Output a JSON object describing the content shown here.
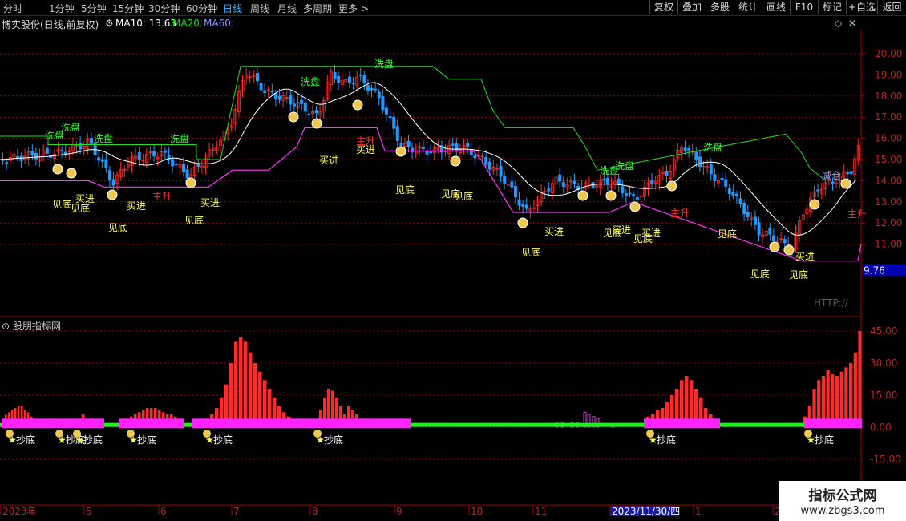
{
  "toolbar": {
    "period_tabs": [
      "分时",
      "1分钟",
      "5分钟",
      "15分钟",
      "30分钟",
      "60分钟",
      "日线",
      "周线",
      "月线",
      "多周期",
      "更多 >"
    ],
    "active_tab": "日线",
    "buttons": [
      "复权",
      "叠加",
      "多股",
      "统计",
      "画线",
      "F10",
      "标记",
      "+自选",
      "返回"
    ]
  },
  "infobar": {
    "stock_title": "博实股份(日线,前复权)",
    "ma10_label": "MA10: 13.63",
    "ma20_label": "MA20:",
    "ma60_label": "MA60:",
    "ma10_color": "#ffffff",
    "ma20_color": "#00e600",
    "ma60_color": "#8f8fff"
  },
  "price_axis": {
    "ticks": [
      "20.00",
      "19.00",
      "18.00",
      "17.00",
      "16.00",
      "15.00",
      "14.00",
      "13.00",
      "12.00",
      "11.00"
    ],
    "current_price": "9.76",
    "current_price_bg": "#0000b0",
    "watermark_text": "HTTP://"
  },
  "annotations": {
    "wash": "洗盘",
    "buy": "买进",
    "bottom": "见底",
    "main_rise": "主升",
    "reduce": "减仓"
  },
  "indicator": {
    "title": "股朋指标网",
    "ticks": [
      "45.00",
      "30.00",
      "15.00",
      "0.00",
      "-15.00"
    ],
    "signal": "抄底"
  },
  "date_axis": {
    "labels": [
      "2023年",
      "5",
      "6",
      "7",
      "8",
      "9",
      "10",
      "11",
      "2023/11/30/四",
      "1",
      "2"
    ]
  },
  "watermark": {
    "line1": "指标公式网",
    "line2": "www.zbgs3.com"
  },
  "colors": {
    "up": "#ff2a2a",
    "down": "#1f9bff",
    "wash_line": "#22dd22",
    "support_line": "#ff33ff",
    "ma_line": "#ffffff",
    "axis_red": "#aa0000",
    "label_yellow": "#ffff55",
    "label_red": "#ff3030",
    "label_green": "#33ff33",
    "signal_bar": "#ff22ff",
    "signal_base": "#22ee22"
  }
}
